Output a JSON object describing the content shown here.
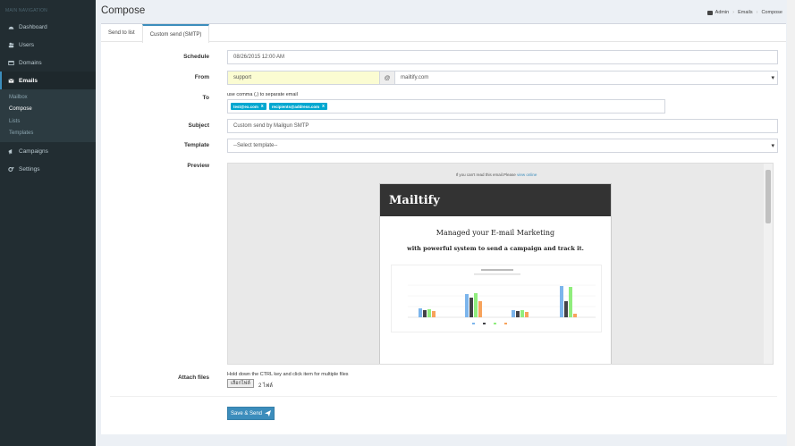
{
  "sidebar": {
    "header": "MAIN NAVIGATION",
    "items": [
      {
        "label": "Dashboard",
        "icon": "dashboard-icon"
      },
      {
        "label": "Users",
        "icon": "users-icon"
      },
      {
        "label": "Domains",
        "icon": "domains-icon"
      },
      {
        "label": "Emails",
        "icon": "envelope-icon"
      },
      {
        "label": "Campaigns",
        "icon": "bullhorn-icon"
      },
      {
        "label": "Settings",
        "icon": "gears-icon"
      }
    ],
    "sub_items": [
      "Mailbox",
      "Compose",
      "Lists",
      "Templates"
    ]
  },
  "header": {
    "title": "Compose",
    "breadcrumb": [
      "Admin",
      "Emails",
      "Compose"
    ]
  },
  "tabs": [
    "Send to list",
    "Custom send (SMTP)"
  ],
  "form": {
    "schedule_label": "Schedule",
    "schedule_value": "08/26/2015 12:00 AM",
    "from_label": "From",
    "from_user": "support",
    "at_sign": "@",
    "from_domain": "mailtify.com",
    "to_label": "To",
    "to_hint": "use comma (,) to separate email",
    "to_tags": [
      "test@ex.com",
      "recipients@address.com"
    ],
    "tag_remove": "x",
    "subject_label": "Subject",
    "subject_value": "Custom send by Mailgun SMTP",
    "template_label": "Template",
    "template_value": "--Select template--",
    "preview_label": "Preview",
    "attach_label": "Attach files",
    "attach_hint": "Hold down the CTRL key and click item for multiple files",
    "file_button": "เลือกไฟล์",
    "file_count": "2 ไฟล์",
    "submit_label": "Save & Send"
  },
  "preview": {
    "note": "If you can't read this email.Please",
    "note_link": "view online",
    "brand": "Mailtify",
    "headline": "Managed your E-mail Marketing",
    "subheadline": "with powerful system to send a campaign and track it."
  },
  "colors": {
    "sidebar": "#222d32",
    "accent": "#3c8dbc",
    "tag": "#00a7d0",
    "from_highlight": "#fbfcd2"
  }
}
